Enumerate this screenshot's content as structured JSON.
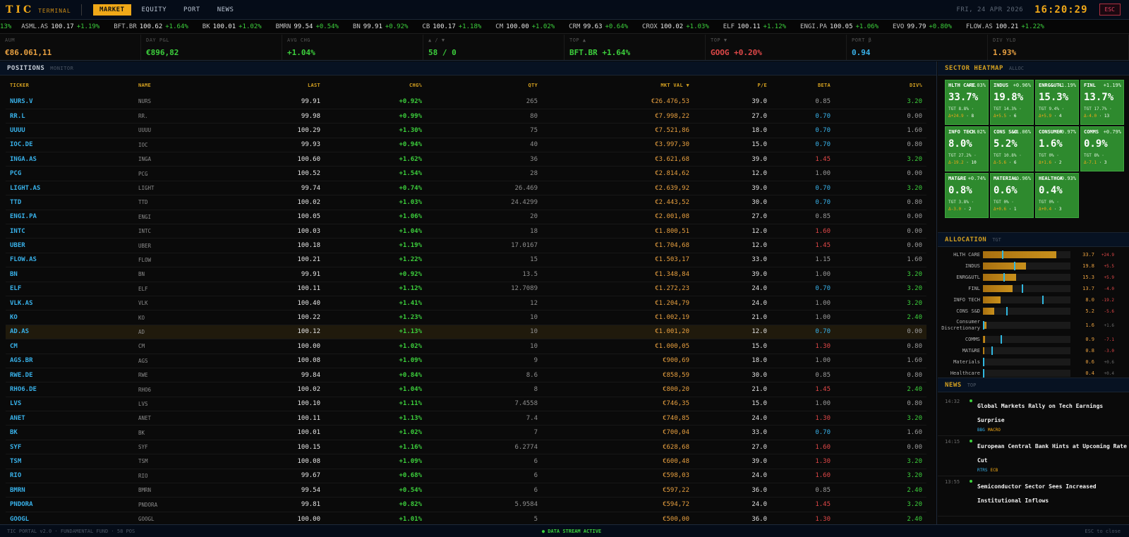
{
  "brand": {
    "tic": "TIC",
    "terminal": "TERMINAL"
  },
  "nav": {
    "tabs": [
      "MARKET",
      "EQUITY",
      "PORT",
      "NEWS"
    ],
    "active": "MARKET"
  },
  "top": {
    "date": "FRI, 24 APR 2026",
    "clock": "16:20:29",
    "esc": "ESC"
  },
  "ticker": {
    "first_change": "13%",
    "items": [
      {
        "s": "ASML.AS",
        "p": "100.17",
        "c": "+1.19%"
      },
      {
        "s": "BFT.BR",
        "p": "100.62",
        "c": "+1.64%"
      },
      {
        "s": "BK",
        "p": "100.01",
        "c": "+1.02%"
      },
      {
        "s": "BMRN",
        "p": "99.54",
        "c": "+0.54%"
      },
      {
        "s": "BN",
        "p": "99.91",
        "c": "+0.92%"
      },
      {
        "s": "CB",
        "p": "100.17",
        "c": "+1.18%"
      },
      {
        "s": "CM",
        "p": "100.00",
        "c": "+1.02%"
      },
      {
        "s": "CRM",
        "p": "99.63",
        "c": "+0.64%"
      },
      {
        "s": "CROX",
        "p": "100.02",
        "c": "+1.03%"
      },
      {
        "s": "ELF",
        "p": "100.11",
        "c": "+1.12%"
      },
      {
        "s": "ENGI.PA",
        "p": "100.05",
        "c": "+1.06%"
      },
      {
        "s": "EVO",
        "p": "99.79",
        "c": "+0.80%"
      },
      {
        "s": "FLOW.AS",
        "p": "100.21",
        "c": "+1.22%"
      }
    ]
  },
  "stats": [
    {
      "label": "AUM",
      "value": "€86.061,11",
      "color": "#e8a040"
    },
    {
      "label": "DAY P&L",
      "value": "€896,82",
      "color": "#3ccf3c"
    },
    {
      "label": "AVG CHG",
      "value": "+1.04%",
      "color": "#3ccf3c"
    },
    {
      "label": "▲ / ▼",
      "value": "58 / 0",
      "color": "#3ccf3c"
    },
    {
      "label": "TOP ▲",
      "value": "BFT.BR +1.64%",
      "color": "#3ccf3c"
    },
    {
      "label": "TOP ▼",
      "value": "GOOG +0.20%",
      "color": "#e04848"
    },
    {
      "label": "PORT β",
      "value": "0.94",
      "color": "#38b0e8"
    },
    {
      "label": "DIV YLD",
      "value": "1.93%",
      "color": "#e8a040"
    }
  ],
  "positions": {
    "title": "POSITIONS",
    "sub": "MONITOR",
    "columns": [
      "TICKER",
      "NAME",
      "LAST",
      "CHG%",
      "QTY",
      "MKT VAL ▼",
      "P/E",
      "BETA",
      "DIV%"
    ],
    "rows": [
      [
        "NURS.V",
        "NURS",
        "99.91",
        "+0.92%",
        "265",
        "€26.476,53",
        "39.0",
        "0.85",
        "3.20"
      ],
      [
        "RR.L",
        "RR.",
        "99.98",
        "+0.99%",
        "80",
        "€7.998,22",
        "27.0",
        "0.70",
        "0.00"
      ],
      [
        "UUUU",
        "UUUU",
        "100.29",
        "+1.30%",
        "75",
        "€7.521,86",
        "18.0",
        "0.70",
        "1.60"
      ],
      [
        "IOC.DE",
        "IOC",
        "99.93",
        "+0.94%",
        "40",
        "€3.997,30",
        "15.0",
        "0.70",
        "0.80"
      ],
      [
        "INGA.AS",
        "INGA",
        "100.60",
        "+1.62%",
        "36",
        "€3.621,68",
        "39.0",
        "1.45",
        "3.20"
      ],
      [
        "PCG",
        "PCG",
        "100.52",
        "+1.54%",
        "28",
        "€2.814,62",
        "12.0",
        "1.00",
        "0.00"
      ],
      [
        "LIGHT.AS",
        "LIGHT",
        "99.74",
        "+0.74%",
        "26.469",
        "€2.639,92",
        "39.0",
        "0.70",
        "3.20"
      ],
      [
        "TTD",
        "TTD",
        "100.02",
        "+1.03%",
        "24.4299",
        "€2.443,52",
        "30.0",
        "0.70",
        "0.80"
      ],
      [
        "ENGI.PA",
        "ENGI",
        "100.05",
        "+1.06%",
        "20",
        "€2.001,08",
        "27.0",
        "0.85",
        "0.00"
      ],
      [
        "INTC",
        "INTC",
        "100.03",
        "+1.04%",
        "18",
        "€1.800,51",
        "12.0",
        "1.60",
        "0.00"
      ],
      [
        "UBER",
        "UBER",
        "100.18",
        "+1.19%",
        "17.0167",
        "€1.704,68",
        "12.0",
        "1.45",
        "0.00"
      ],
      [
        "FLOW.AS",
        "FLOW",
        "100.21",
        "+1.22%",
        "15",
        "€1.503,17",
        "33.0",
        "1.15",
        "1.60"
      ],
      [
        "BN",
        "BN",
        "99.91",
        "+0.92%",
        "13.5",
        "€1.348,84",
        "39.0",
        "1.00",
        "3.20"
      ],
      [
        "ELF",
        "ELF",
        "100.11",
        "+1.12%",
        "12.7089",
        "€1.272,23",
        "24.0",
        "0.70",
        "3.20"
      ],
      [
        "VLK.AS",
        "VLK",
        "100.40",
        "+1.41%",
        "12",
        "€1.204,79",
        "24.0",
        "1.00",
        "3.20"
      ],
      [
        "KO",
        "KO",
        "100.22",
        "+1.23%",
        "10",
        "€1.002,19",
        "21.0",
        "1.00",
        "2.40"
      ],
      [
        "AD.AS",
        "AD",
        "100.12",
        "+1.13%",
        "10",
        "€1.001,20",
        "12.0",
        "0.70",
        "0.00"
      ],
      [
        "CM",
        "CM",
        "100.00",
        "+1.02%",
        "10",
        "€1.000,05",
        "15.0",
        "1.30",
        "0.80"
      ],
      [
        "AGS.BR",
        "AGS",
        "100.08",
        "+1.09%",
        "9",
        "€900,69",
        "18.0",
        "1.00",
        "1.60"
      ],
      [
        "RWE.DE",
        "RWE",
        "99.84",
        "+0.84%",
        "8.6",
        "€858,59",
        "30.0",
        "0.85",
        "0.80"
      ],
      [
        "RHO6.DE",
        "RHO6",
        "100.02",
        "+1.04%",
        "8",
        "€800,20",
        "21.0",
        "1.45",
        "2.40"
      ],
      [
        "LVS",
        "LVS",
        "100.10",
        "+1.11%",
        "7.4558",
        "€746,35",
        "15.0",
        "1.00",
        "0.80"
      ],
      [
        "ANET",
        "ANET",
        "100.11",
        "+1.13%",
        "7.4",
        "€740,85",
        "24.0",
        "1.30",
        "3.20"
      ],
      [
        "BK",
        "BK",
        "100.01",
        "+1.02%",
        "7",
        "€700,04",
        "33.0",
        "0.70",
        "1.60"
      ],
      [
        "SYF",
        "SYF",
        "100.15",
        "+1.16%",
        "6.2774",
        "€628,68",
        "27.0",
        "1.60",
        "0.00"
      ],
      [
        "TSM",
        "TSM",
        "100.08",
        "+1.09%",
        "6",
        "€600,48",
        "39.0",
        "1.30",
        "3.20"
      ],
      [
        "RIO",
        "RIO",
        "99.67",
        "+0.68%",
        "6",
        "€598,03",
        "24.0",
        "1.60",
        "3.20"
      ],
      [
        "BMRN",
        "BMRN",
        "99.54",
        "+0.54%",
        "6",
        "€597,22",
        "36.0",
        "0.85",
        "2.40"
      ],
      [
        "PNDORA",
        "PNDORA",
        "99.81",
        "+0.82%",
        "5.9584",
        "€594,72",
        "24.0",
        "1.45",
        "3.20"
      ],
      [
        "GOOGL",
        "GOOGL",
        "100.00",
        "+1.01%",
        "5",
        "€500,00",
        "36.0",
        "1.30",
        "2.40"
      ]
    ],
    "highlight": "AD.AS"
  },
  "heatmap": {
    "title": "SECTOR HEATMAP",
    "sub": "ALLOC",
    "tiles": [
      {
        "name": "HLTH CARE",
        "chg": "+1.03%",
        "weight": "33.7%",
        "tgt": "TGT 8.8%",
        "delta": "Δ+24.9",
        "n": "8"
      },
      {
        "name": "INDUS",
        "chg": "+0.96%",
        "weight": "19.8%",
        "tgt": "TGT 14.3%",
        "delta": "Δ+5.5",
        "n": "6"
      },
      {
        "name": "ENRG&UTL",
        "chg": "+1.19%",
        "weight": "15.3%",
        "tgt": "TGT 9.4%",
        "delta": "Δ+5.9",
        "n": "4"
      },
      {
        "name": "FINL",
        "chg": "+1.19%",
        "weight": "13.7%",
        "tgt": "TGT 17.7%",
        "delta": "Δ-4.0",
        "n": "13"
      },
      {
        "name": "INFO TECH",
        "chg": "+1.02%",
        "weight": "8.0%",
        "tgt": "TGT 27.2%",
        "delta": "Δ-19.2",
        "n": "10"
      },
      {
        "name": "CONS S&D",
        "chg": "+1.06%",
        "weight": "5.2%",
        "tgt": "TGT 10.8%",
        "delta": "Δ-5.6",
        "n": "6"
      },
      {
        "name": "CONSUMER",
        "chg": "+0.97%",
        "weight": "1.6%",
        "tgt": "TGT 0%",
        "delta": "Δ+1.6",
        "n": "2"
      },
      {
        "name": "COMMS",
        "chg": "+0.79%",
        "weight": "0.9%",
        "tgt": "TGT 8%",
        "delta": "Δ-7.1",
        "n": "3"
      },
      {
        "name": "MAT&RE",
        "chg": "+0.74%",
        "weight": "0.8%",
        "tgt": "TGT 3.8%",
        "delta": "Δ-3.0",
        "n": "2"
      },
      {
        "name": "MATERIAL",
        "chg": "+0.96%",
        "weight": "0.6%",
        "tgt": "TGT 0%",
        "delta": "Δ+0.6",
        "n": "1"
      },
      {
        "name": "HEALTHCA",
        "chg": "+0.93%",
        "weight": "0.4%",
        "tgt": "TGT 0%",
        "delta": "Δ+0.4",
        "n": "3"
      }
    ]
  },
  "allocation": {
    "title": "ALLOCATION",
    "sub": "TGT",
    "rows": [
      {
        "label": "HLTH CARE",
        "value": 33.7,
        "target": 8.8,
        "delta": "+24.9"
      },
      {
        "label": "INDUS",
        "value": 19.8,
        "target": 14.3,
        "delta": "+5.5"
      },
      {
        "label": "ENRG&UTL",
        "value": 15.3,
        "target": 9.4,
        "delta": "+5.9"
      },
      {
        "label": "FINL",
        "value": 13.7,
        "target": 17.7,
        "delta": "-4.0"
      },
      {
        "label": "INFO TECH",
        "value": 8.0,
        "target": 27.2,
        "delta": "-19.2"
      },
      {
        "label": "CONS S&D",
        "value": 5.2,
        "target": 10.8,
        "delta": "-5.6"
      },
      {
        "label": "Consumer Discretionary",
        "value": 1.6,
        "target": 0,
        "delta": "+1.6"
      },
      {
        "label": "COMMS",
        "value": 0.9,
        "target": 8.0,
        "delta": "-7.1"
      },
      {
        "label": "MAT&RE",
        "value": 0.8,
        "target": 3.8,
        "delta": "-3.0"
      },
      {
        "label": "Materials",
        "value": 0.6,
        "target": 0,
        "delta": "+0.6"
      },
      {
        "label": "Healthcare",
        "value": 0.4,
        "target": 0,
        "delta": "+0.4"
      }
    ],
    "scale_max": 40
  },
  "news": {
    "title": "NEWS",
    "sub": "TOP",
    "items": [
      {
        "time": "14:32",
        "headline": "Global Markets Rally on Tech Earnings Surprise",
        "source": "BBG",
        "tag": "MACRO"
      },
      {
        "time": "14:15",
        "headline": "European Central Bank Hints at Upcoming Rate Cut",
        "source": "RTRS",
        "tag": "ECB"
      },
      {
        "time": "13:55",
        "headline": "Semiconductor Sector Sees Increased Institutional Inflows",
        "source": "",
        "tag": ""
      }
    ]
  },
  "footer": {
    "left": "TIC PORTAL v2.0 · FUNDAMENTAL FUND · 58 POS",
    "mid": "● DATA STREAM ACTIVE",
    "right": "ESC to close"
  }
}
